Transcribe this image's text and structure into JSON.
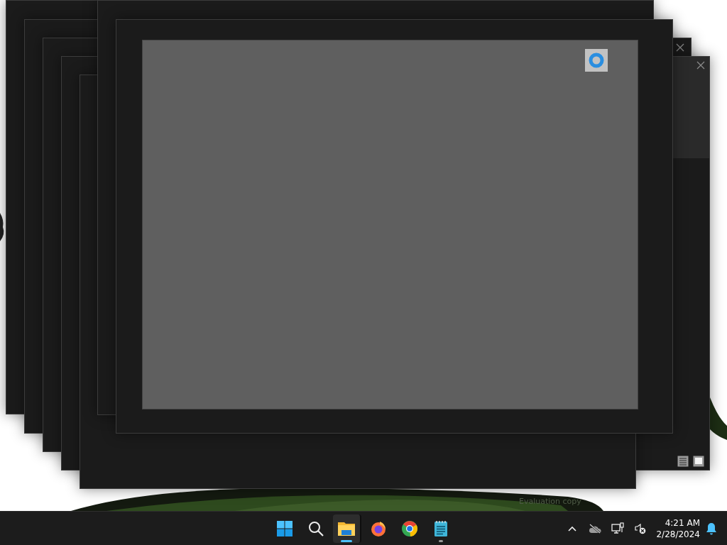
{
  "desktop": {
    "watermark_text": "Evaluation copy"
  },
  "taskbar": {
    "apps": [
      {
        "kind": "start",
        "selected": false,
        "running": false
      },
      {
        "kind": "search",
        "selected": false,
        "running": false
      },
      {
        "kind": "explorer",
        "selected": true,
        "running": true
      },
      {
        "kind": "firefox",
        "selected": false,
        "running": false
      },
      {
        "kind": "chrome",
        "selected": false,
        "running": false
      },
      {
        "kind": "notepad",
        "selected": false,
        "running": true
      }
    ],
    "tray": {
      "time": "4:21 AM",
      "date": "2/28/2024"
    }
  }
}
